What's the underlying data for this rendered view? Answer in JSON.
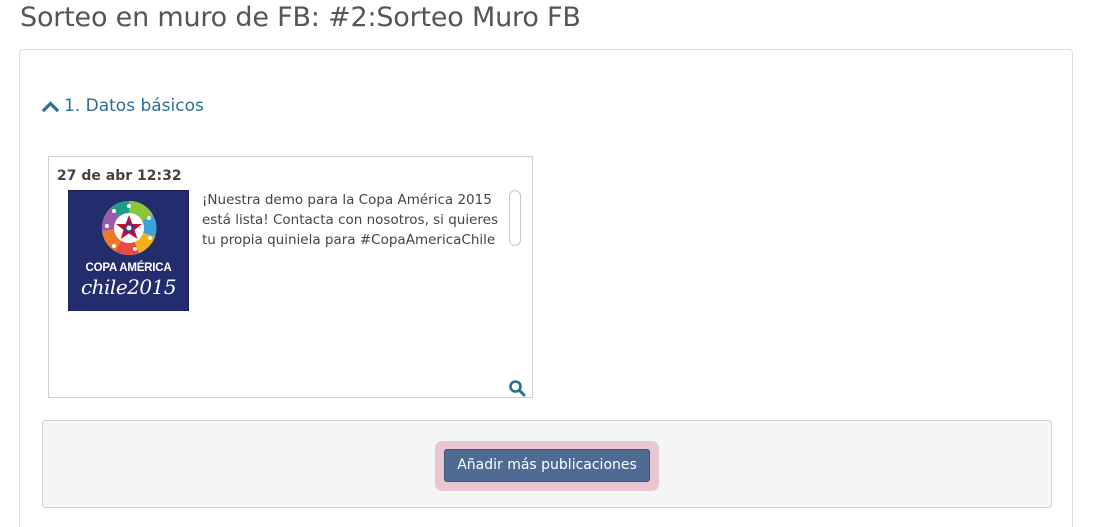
{
  "page": {
    "title": "Sorteo en muro de FB: #2:Sorteo Muro FB"
  },
  "section": {
    "label": "1. Datos básicos",
    "icon": "chevron-up-icon",
    "color": "#2b6f96"
  },
  "post": {
    "date": "27 de abr 12:32",
    "text": "¡Nuestra demo para la Copa América 2015 está lista! Contacta con nosotros, si quieres tu propia quiniela para #CopaAmericaChile",
    "image": {
      "line1": "COPA AMÉRICA",
      "line2": "chile2015",
      "background": "#232d6e"
    },
    "zoom_icon": "magnifier-icon"
  },
  "actions": {
    "add_more_label": "Añadir más publicaciones",
    "button_color": "#4f6b93"
  }
}
